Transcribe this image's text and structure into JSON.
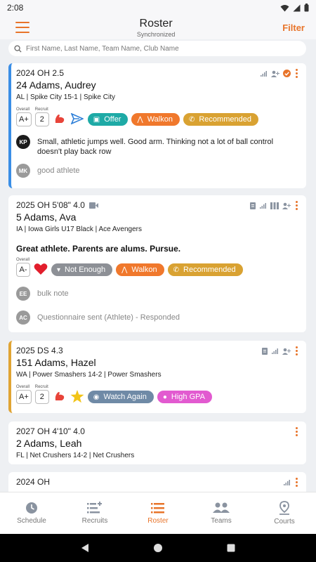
{
  "status": {
    "time": "2:08"
  },
  "header": {
    "title": "Roster",
    "subtitle": "Synchronized",
    "filter_label": "Filter"
  },
  "search": {
    "placeholder": "First Name, Last Name, Team Name, Club Name"
  },
  "colors": {
    "accent": "#e8742a",
    "offer": "#1eaaa6",
    "walkon": "#f0782c",
    "recommended": "#d9a232",
    "not_enough": "#8d9096",
    "watch_again": "#6f8aa6",
    "high_gpa": "#e25ad0"
  },
  "cards": [
    {
      "line1": "2024 OH 2.5",
      "name": "24 Adams, Audrey",
      "club": "AL | Spike City 15-1 | Spike City",
      "overall_label": "Overall",
      "overall": "A+",
      "recruit_label": "Recruit",
      "recruit": "2",
      "tags": [
        "Offer",
        "Walkon",
        "Recommended"
      ],
      "notes": [
        {
          "initials": "KP",
          "text": "Small, athletic jumps well. Good arm. Thinking not a lot of ball control doesn't play back row"
        },
        {
          "initials": "MK",
          "text": "good athlete"
        }
      ]
    },
    {
      "line1": "2025 OH 5'08\" 4.0",
      "name": "5 Adams, Ava",
      "club": "IA | Iowa Girls U17 Black | Ace Avengers",
      "bold_note": "Great athlete. Parents are alums. Pursue.",
      "overall_label": "Overall",
      "overall": "A-",
      "tags": [
        "Not Enough",
        "Walkon",
        "Recommended"
      ],
      "notes": [
        {
          "initials": "EE",
          "text": "bulk note"
        },
        {
          "initials": "AC",
          "text": "Questionnaire sent (Athlete) - Responded"
        }
      ]
    },
    {
      "line1": "2025 DS 4.3",
      "name": "151 Adams, Hazel",
      "club": "WA | Power Smashers 14-2 | Power Smashers",
      "overall_label": "Overall",
      "overall": "A+",
      "recruit_label": "Recruit",
      "recruit": "2",
      "tags": [
        "Watch Again",
        "High GPA"
      ]
    },
    {
      "line1": "2027 OH 4'10\" 4.0",
      "name": "2 Adams, Leah",
      "club": "FL | Net Crushers 14-2 | Net Crushers"
    },
    {
      "line1": "2024 OH"
    }
  ],
  "nav": [
    {
      "label": "Schedule",
      "icon": "clock-icon"
    },
    {
      "label": "Recruits",
      "icon": "list-add-icon"
    },
    {
      "label": "Roster",
      "icon": "list-icon",
      "active": true
    },
    {
      "label": "Teams",
      "icon": "people-icon"
    },
    {
      "label": "Courts",
      "icon": "map-pin-icon"
    }
  ]
}
